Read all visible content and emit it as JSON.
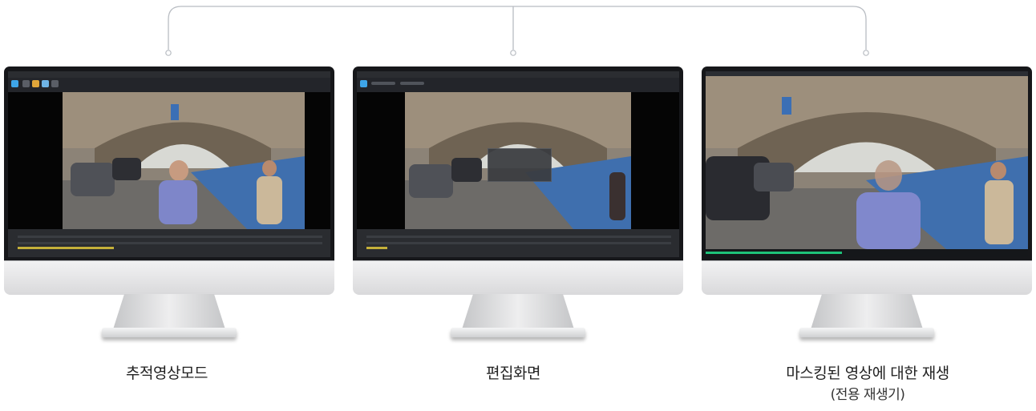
{
  "captions": {
    "tracking": "추적영상모드",
    "editing": "편집화면",
    "playback": "마스킹된 영상에 대한 재생",
    "playback_sub": "(전용 재생기)"
  },
  "colors": {
    "line": "#b8bcc2",
    "bezel": "#16171a",
    "app_accent": "#3ea5e8",
    "player_progress": "#1ec27a"
  }
}
